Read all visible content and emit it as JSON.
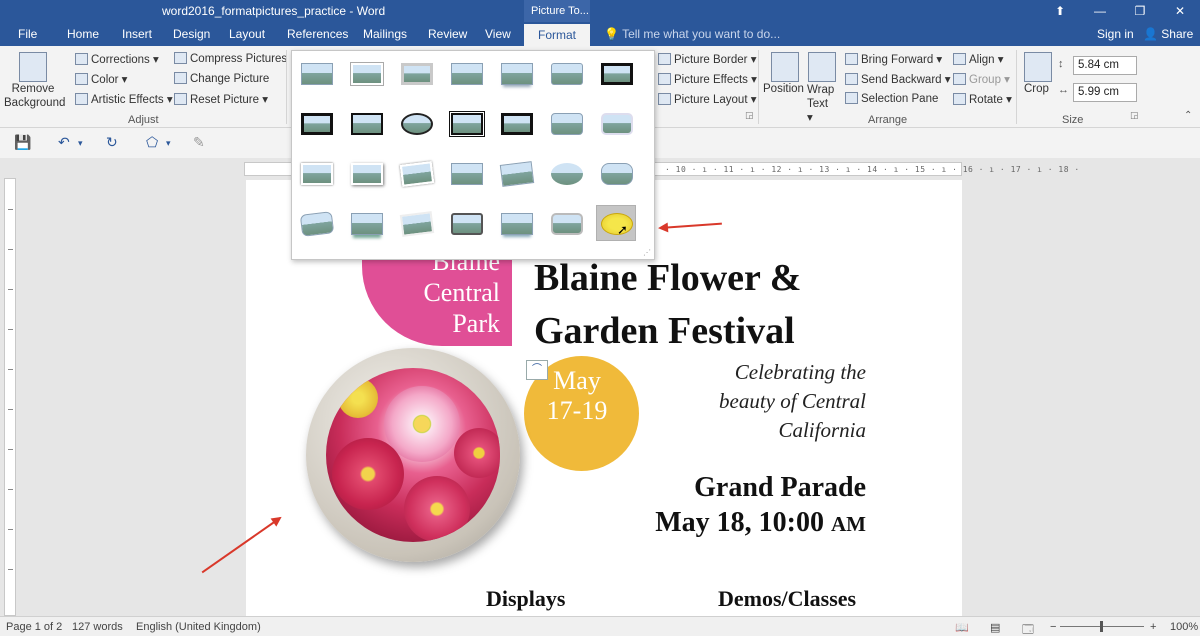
{
  "window": {
    "title": "word2016_formatpictures_practice - Word",
    "context_tab_header": "Picture To...",
    "controls": [
      "⬆",
      "—",
      "❐",
      "✕"
    ]
  },
  "tabs": [
    "File",
    "Home",
    "Insert",
    "Design",
    "Layout",
    "References",
    "Mailings",
    "Review",
    "View",
    "Format"
  ],
  "active_tab": "Format",
  "tell_me": "Tell me what you want to do...",
  "signin": "Sign in",
  "share": "Share",
  "ribbon": {
    "adjust": {
      "remove_background": "Remove Background",
      "corrections": "Corrections ▾",
      "color": "Color ▾",
      "artistic_effects": "Artistic Effects ▾",
      "compress": "Compress Pictures",
      "change": "Change Picture",
      "reset": "Reset Picture ▾",
      "label": "Adjust"
    },
    "picture_styles": {
      "border": "Picture Border ▾",
      "effects": "Picture Effects ▾",
      "layout": "Picture Layout ▾"
    },
    "arrange": {
      "position": "Position",
      "wrap_text": "Wrap Text ▾",
      "bring_forward": "Bring Forward ▾",
      "send_backward": "Send Backward ▾",
      "selection_pane": "Selection Pane",
      "align": "Align ▾",
      "group": "Group ▾",
      "rotate": "Rotate ▾",
      "label": "Arrange"
    },
    "size": {
      "crop": "Crop",
      "height": "5.84 cm",
      "width": "5.99 cm",
      "label": "Size"
    }
  },
  "ruler_numbers": "· 10 · ı · 11 · ı · 12 · ı · 13 · ı · 14 · ı · 15 · ı · 16 · ı · 17 · ı · 18 ·",
  "gallery": {
    "rows": 4,
    "cols": 7,
    "selected_row": 3,
    "selected_col": 6
  },
  "document": {
    "location_lines": [
      "Blaine",
      "Central",
      "Park"
    ],
    "title_lines": [
      "Blaine Flower &",
      "Garden Festival"
    ],
    "date_lines": [
      "May",
      "17-19"
    ],
    "tagline_lines": [
      "Celebrating the",
      "beauty of Central",
      "California"
    ],
    "parade_title": "Grand Parade",
    "parade_date": "May 18, 10:00 ",
    "parade_ampm": "AM",
    "section_displays": "Displays",
    "section_demos": "Demos/Classes"
  },
  "status": {
    "page": "Page 1 of 2",
    "words": "127 words",
    "language": "English (United Kingdom)",
    "zoom": "100%"
  }
}
